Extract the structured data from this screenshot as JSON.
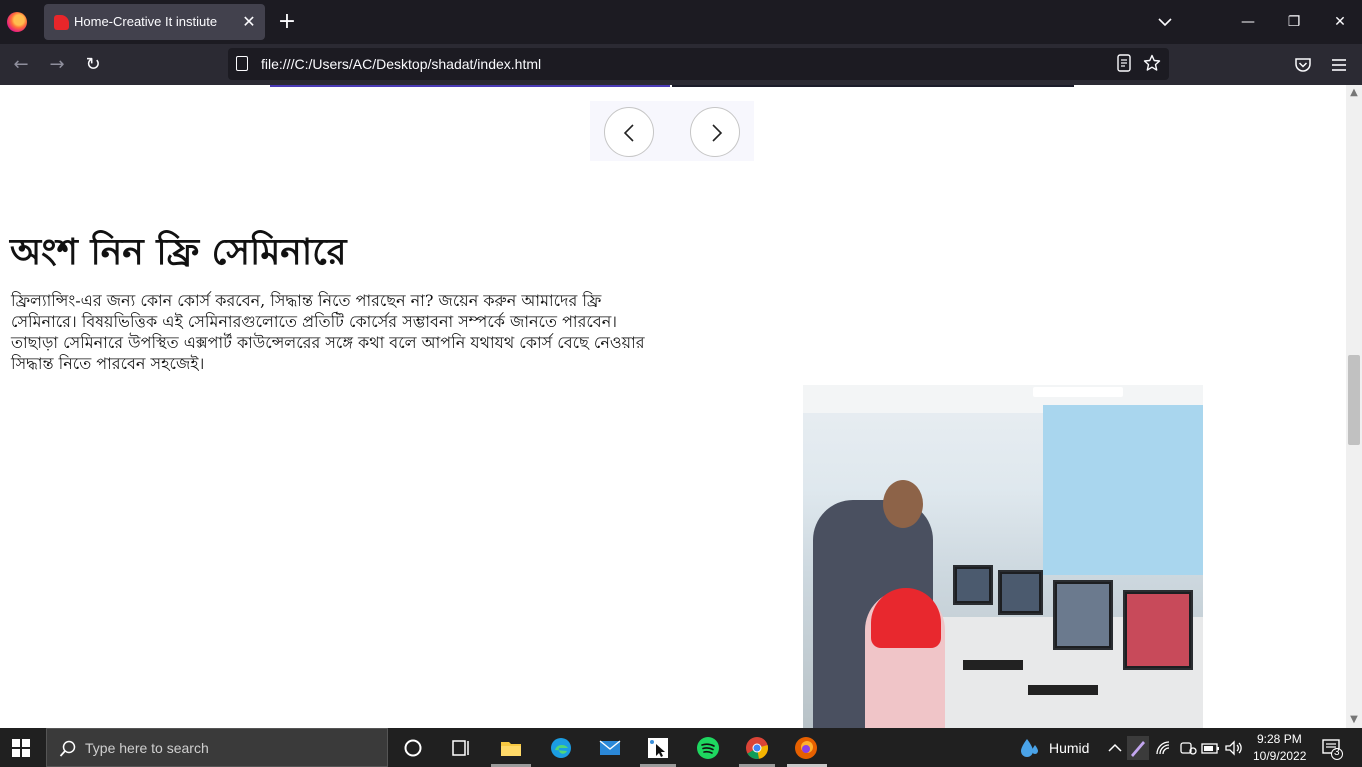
{
  "browser": {
    "tab_title": "Home-Creative It instiute",
    "tab_close": "✕",
    "new_tab": "+",
    "url": "file:///C:/Users/AC/Desktop/shadat/index.html",
    "window_controls": {
      "minimize": "—",
      "restore": "❐",
      "close": "✕"
    },
    "nav": {
      "back": "←",
      "forward": "→",
      "reload": "↻"
    },
    "icons": [
      "firefox-logo",
      "reader-view-icon",
      "bookmark-star-icon",
      "pocket-icon",
      "menu-icon"
    ]
  },
  "page": {
    "carousel": {
      "prev_icon": "chevron-left-icon",
      "next_icon": "chevron-right-icon"
    },
    "seminar": {
      "title": "অংশ নিন ফ্রি সেমিনারে",
      "description": "ফ্রিল্যান্সিং-এর জন্য কোন কোর্স করবেন, সিদ্ধান্ত নিতে পারছেন না? জয়েন করুন আমাদের ফ্রি সেমিনারে। বিষয়ভিত্তিক এই সেমিনারগুলোতে প্রতিটি কোর্সের সম্ভাবনা সম্পর্কে জানতে পারবেন। তাছাড়া সেমিনারে উপস্থিত এক্সপার্ট কাউন্সেলরের সঙ্গে কথা বলে আপনি যথাযথ কোর্স বেছে নেওয়ার সিদ্ধান্ত নিতে পারবেন সহজেই।"
    },
    "colors": {
      "strip_left": "#4b3bb8",
      "strip_right": "#1b1c2a"
    }
  },
  "taskbar": {
    "search_placeholder": "Type here to search",
    "weather": "Humid",
    "time": "9:28 PM",
    "date": "10/9/2022",
    "notification_count": "3",
    "apps": [
      "cortana-icon",
      "task-view-icon",
      "file-explorer-icon",
      "edge-icon",
      "mail-icon",
      "snipping-icon",
      "spotify-icon",
      "chrome-icon",
      "firefox-icon"
    ]
  }
}
